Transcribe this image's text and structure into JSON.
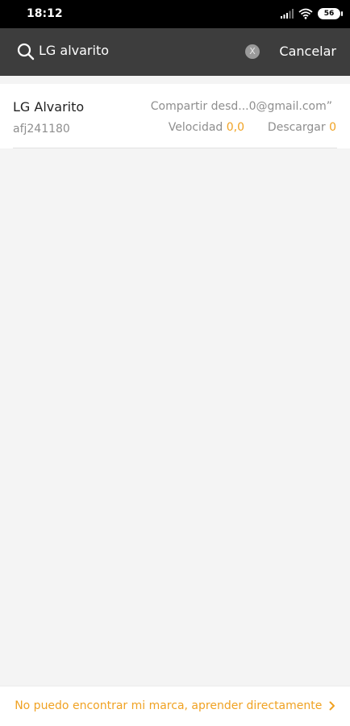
{
  "status_bar": {
    "time": "18:12",
    "battery": "56"
  },
  "search": {
    "query": "LG alvarito",
    "clear_label": "X",
    "cancel_label": "Cancelar"
  },
  "result": {
    "name": "LG Alvarito",
    "id": "afj241180",
    "share_text": "Compartir desd...0@gmail.com”",
    "speed_label": "Velocidad",
    "speed_value": "0,0",
    "download_label": "Descargar",
    "download_value": "0"
  },
  "footer": {
    "link_text": "No puedo encontrar mi marca, aprender directamente"
  },
  "colors": {
    "accent": "#f0a223",
    "header_bg": "#3d3d3d",
    "page_bg": "#f4f4f4"
  },
  "icons": [
    "signal-icon",
    "wifi-icon",
    "battery-icon",
    "search-icon",
    "clear-icon",
    "chevron-right-icon"
  ]
}
